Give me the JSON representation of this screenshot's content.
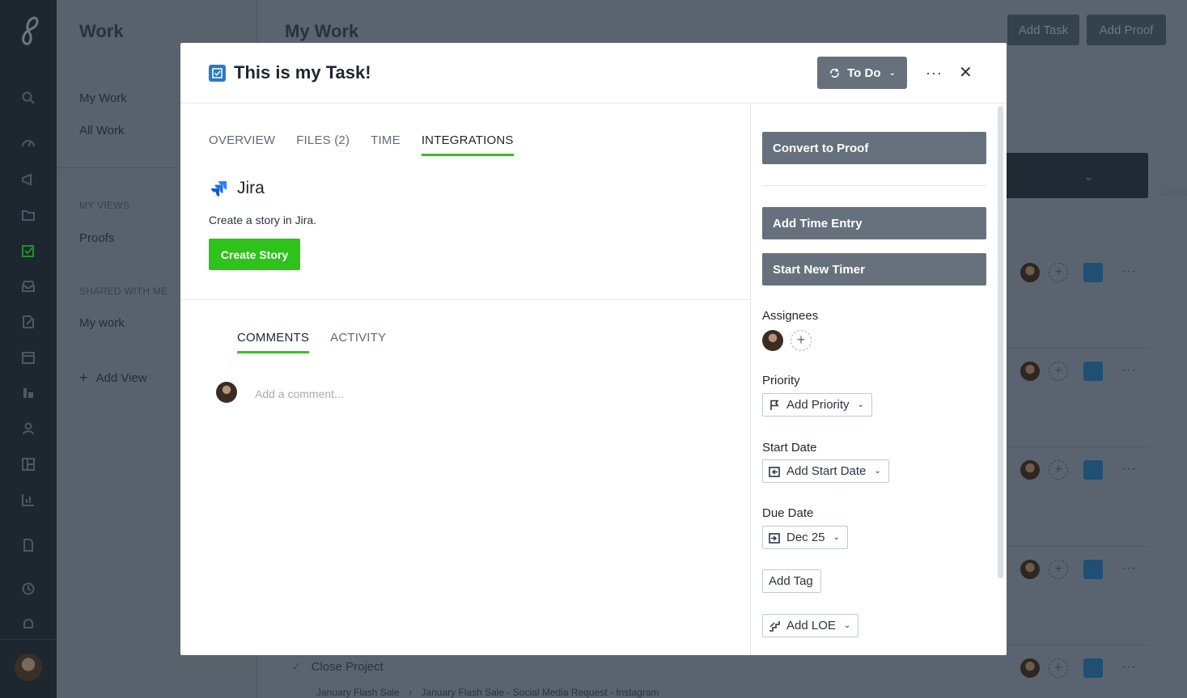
{
  "background": {
    "work_title": "Work",
    "nav": [
      "My Work",
      "All Work"
    ],
    "my_views_heading": "MY VIEWS",
    "my_views": [
      "Proofs"
    ],
    "shared_heading": "SHARED WITH ME",
    "shared": [
      "My work"
    ],
    "add_view": "Add View",
    "main_title": "My Work",
    "add_task": "Add Task",
    "add_proof": "Add Proof",
    "clear": "Clear",
    "bottom_task": "Close Project",
    "bottom_crumb_1": "January Flash Sale",
    "bottom_crumb_2": "January Flash Sale - Social Media Request - Instagram"
  },
  "modal": {
    "title": "This is my Task!",
    "status": "To Do",
    "tabs": [
      "OVERVIEW",
      "FILES (2)",
      "TIME",
      "INTEGRATIONS"
    ],
    "active_tab": "INTEGRATIONS",
    "integration": {
      "name": "Jira",
      "description": "Create a story in Jira.",
      "button": "Create Story"
    },
    "comment_tabs": [
      "COMMENTS",
      "ACTIVITY"
    ],
    "comment_placeholder": "Add a comment...",
    "sidebar": {
      "convert": "Convert to Proof",
      "add_time": "Add Time Entry",
      "start_timer": "Start New Timer",
      "assignees_label": "Assignees",
      "priority_label": "Priority",
      "priority_value": "Add Priority",
      "start_label": "Start Date",
      "start_value": "Add Start Date",
      "due_label": "Due Date",
      "due_value": "Dec 25",
      "tag": "Add Tag",
      "loe": "Add LOE"
    }
  },
  "colors": {
    "accent_green": "#2ec21a",
    "slate_button": "#66717d",
    "task_blue": "#2c7ac6",
    "rail": "#1d2730"
  }
}
